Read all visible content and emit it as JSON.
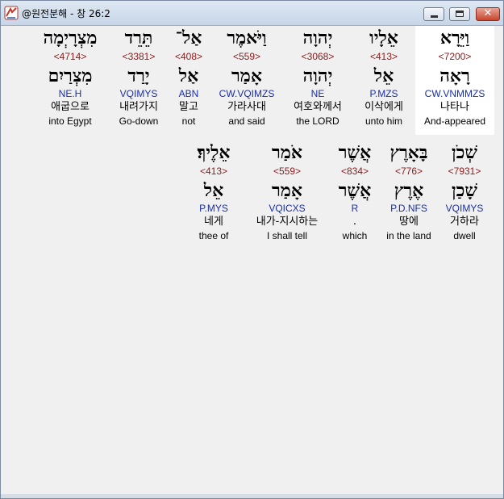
{
  "window": {
    "title": "@원전분해 - 창 26:2"
  },
  "rows": [
    [
      {
        "heb": "וַיֵּרָא",
        "strong": "<7200>",
        "lemma": "רָאָה",
        "parse": "CW.VNMMZS",
        "kor": "나타나",
        "eng": "And-appeared",
        "highlight": true
      },
      {
        "heb": "אֵלָיו",
        "strong": "<413>",
        "lemma": "אֵל",
        "parse": "P.MZS",
        "kor": "이삭에게",
        "eng": "unto him"
      },
      {
        "heb": "יְהוָה",
        "strong": "<3068>",
        "lemma": "יְהוָה",
        "parse": "NE",
        "kor": "여호와께서",
        "eng": "the LORD"
      },
      {
        "heb": "וַיֹּאמֶר",
        "strong": "<559>",
        "lemma": "אָמַר",
        "parse": "CW.VQIMZS",
        "kor": "가라사대",
        "eng": "and said"
      },
      {
        "heb": "אַל־",
        "strong": "<408>",
        "lemma": "אַל",
        "parse": "ABN",
        "kor": "말고",
        "eng": "not"
      },
      {
        "heb": "תֵּרֵד",
        "strong": "<3381>",
        "lemma": "יָרַד",
        "parse": "VQIMYS",
        "kor": "내려가지",
        "eng": "Go-down"
      },
      {
        "heb": "מִצְרָיְמָה",
        "strong": "<4714>",
        "lemma": "מִצְרַיִם",
        "parse": "NE.H",
        "kor": "애굽으로",
        "eng": "into Egypt"
      }
    ],
    [
      {
        "heb": "שְׁכֹן",
        "strong": "<7931>",
        "lemma": "שָׁכַן",
        "parse": "VQIMYS",
        "kor": "거하라",
        "eng": "dwell"
      },
      {
        "heb": "בָּאָרֶץ",
        "strong": "<776>",
        "lemma": "אֶרֶץ",
        "parse": "P.D.NFS",
        "kor": "땅에",
        "eng": "in the land"
      },
      {
        "heb": "אֲשֶׁר",
        "strong": "<834>",
        "lemma": "אֲשֶׁר",
        "parse": "R",
        "kor": ".",
        "eng": "which"
      },
      {
        "heb": "אֹמַר",
        "strong": "<559>",
        "lemma": "אָמַר",
        "parse": "VQICXS",
        "kor": "내가-지시하는",
        "eng": "I shall tell"
      },
      {
        "heb": "אֵלֶיךָ׃",
        "strong": "<413>",
        "lemma": "אֵל",
        "parse": "P.MYS",
        "kor": "네게",
        "eng": "thee of"
      }
    ]
  ]
}
